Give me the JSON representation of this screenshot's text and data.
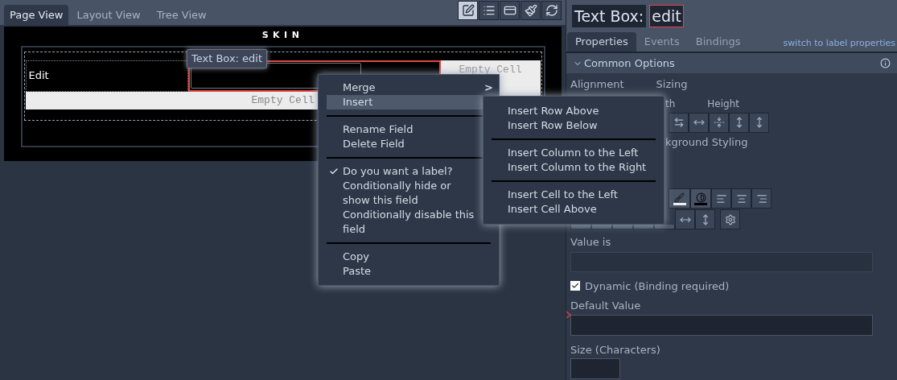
{
  "view_tabs": [
    {
      "label": "Page View",
      "selected": true
    },
    {
      "label": "Layout View",
      "selected": false
    },
    {
      "label": "Tree View",
      "selected": false
    }
  ],
  "toolbar": [
    {
      "kind": "edit",
      "selected": true
    },
    {
      "kind": "list",
      "selected": false
    },
    {
      "kind": "card",
      "selected": false
    },
    {
      "kind": "brush",
      "selected": false
    },
    {
      "kind": "refresh",
      "selected": false
    }
  ],
  "canvas": {
    "title": "SKIN",
    "field_label": "Edit",
    "tooltip": "Text Box: edit",
    "side_cell": "Empty Cell",
    "bottom_cell": "Empty Cell"
  },
  "context_menu": {
    "groups": [
      [
        {
          "label": "Merge",
          "arrow": ">",
          "selected": false
        },
        {
          "label": "Insert",
          "selected": true
        }
      ],
      [
        {
          "label": "Rename Field",
          "selected": false
        },
        {
          "label": "Delete Field",
          "selected": false
        }
      ],
      [
        {
          "label": "Do you want a label?",
          "checked": true,
          "selected": false
        },
        {
          "label": "Conditionally hide or show this field",
          "checked": false,
          "selected": false
        },
        {
          "label": "Conditionally disable this field",
          "checked": false,
          "selected": false
        }
      ],
      [
        {
          "label": "Copy",
          "selected": false
        },
        {
          "label": "Paste",
          "selected": false
        }
      ]
    ]
  },
  "submenu": {
    "groups": [
      [
        "Insert Row Above",
        "Insert Row Below"
      ],
      [
        "Insert Column to the Left",
        "Insert Column to the Right"
      ],
      [
        "Insert Cell to the Left",
        "Insert Cell Above"
      ]
    ]
  },
  "panel": {
    "title_type": "Text Box:",
    "title_name": "edit",
    "tabs": [
      {
        "label": "Properties",
        "selected": true
      },
      {
        "label": "Events",
        "selected": false
      },
      {
        "label": "Bindings",
        "selected": false
      }
    ],
    "link": "switch to label properties",
    "section": {
      "title": "Common Options",
      "expanded": true
    },
    "alignment_label": "Alignment",
    "sizing_label": "Sizing",
    "width_label_part": "th",
    "height_label": "Height",
    "background_label_part": "kground Styling",
    "value_label": "Value is",
    "dynamic": {
      "label": "Dynamic (Binding required)",
      "checked": true
    },
    "default_label": "Default Value",
    "size_label": "Size (Characters)"
  }
}
